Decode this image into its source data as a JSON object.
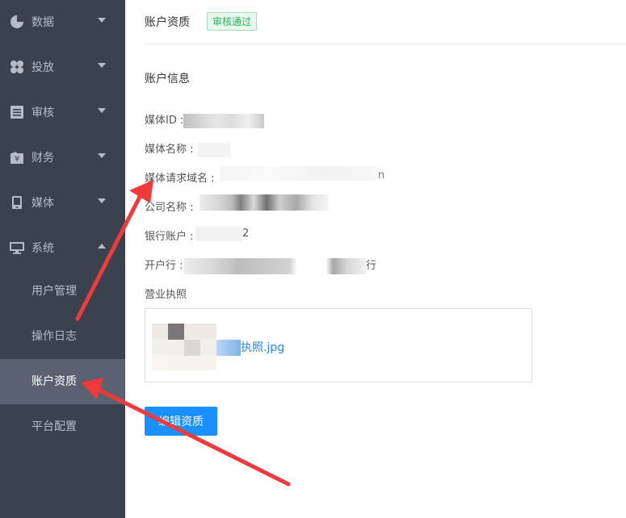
{
  "sidebar": {
    "items": [
      {
        "label": "数据",
        "icon": "pie-chart-icon"
      },
      {
        "label": "投放",
        "icon": "grid-icon"
      },
      {
        "label": "审核",
        "icon": "document-icon"
      },
      {
        "label": "财务",
        "icon": "wallet-icon"
      },
      {
        "label": "媒体",
        "icon": "tablet-icon"
      },
      {
        "label": "系统",
        "icon": "monitor-icon"
      }
    ],
    "sub_items": [
      {
        "label": "用户管理"
      },
      {
        "label": "操作日志"
      },
      {
        "label": "账户资质"
      },
      {
        "label": "平台配置"
      }
    ]
  },
  "header": {
    "title": "账户资质",
    "status": "审核通过"
  },
  "section": {
    "title": "账户信息"
  },
  "fields": {
    "media_id": "媒体ID :",
    "media_name": "媒体名称 :",
    "request_domain": "媒体请求域名 :",
    "company_name": "公司名称 :",
    "bank_account": "银行账户 :",
    "bank_account_tail": "2",
    "bank_branch": "开户行 :",
    "bank_branch_tail": "行",
    "domain_tail": "n",
    "license": "营业执照"
  },
  "license": {
    "file_name": "执照.jpg"
  },
  "actions": {
    "edit": "编辑资质"
  },
  "colors": {
    "sidebar_bg": "#3a4250",
    "sidebar_active": "#5a6170",
    "primary": "#1890ff",
    "success": "#26b15a",
    "annotation": "#f03a3a"
  }
}
